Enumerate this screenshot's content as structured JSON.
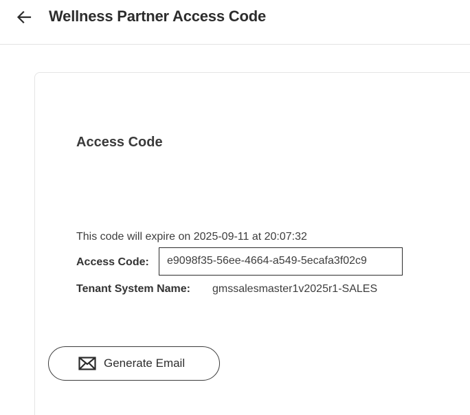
{
  "header": {
    "back_icon": "arrow-left-icon",
    "title": "Wellness Partner Access Code"
  },
  "card": {
    "section_title": "Access Code",
    "expire_text": "This code will expire on 2025-09-11 at 20:07:32",
    "access_code_label": "Access Code:",
    "access_code_value": "e9098f35-56ee-4664-a549-5ecafa3f02c9",
    "tenant_label": "Tenant System Name:",
    "tenant_value": "gmssalesmaster1v2025r1-SALES",
    "generate_email": {
      "icon": "envelope-icon",
      "label": "Generate Email"
    }
  }
}
